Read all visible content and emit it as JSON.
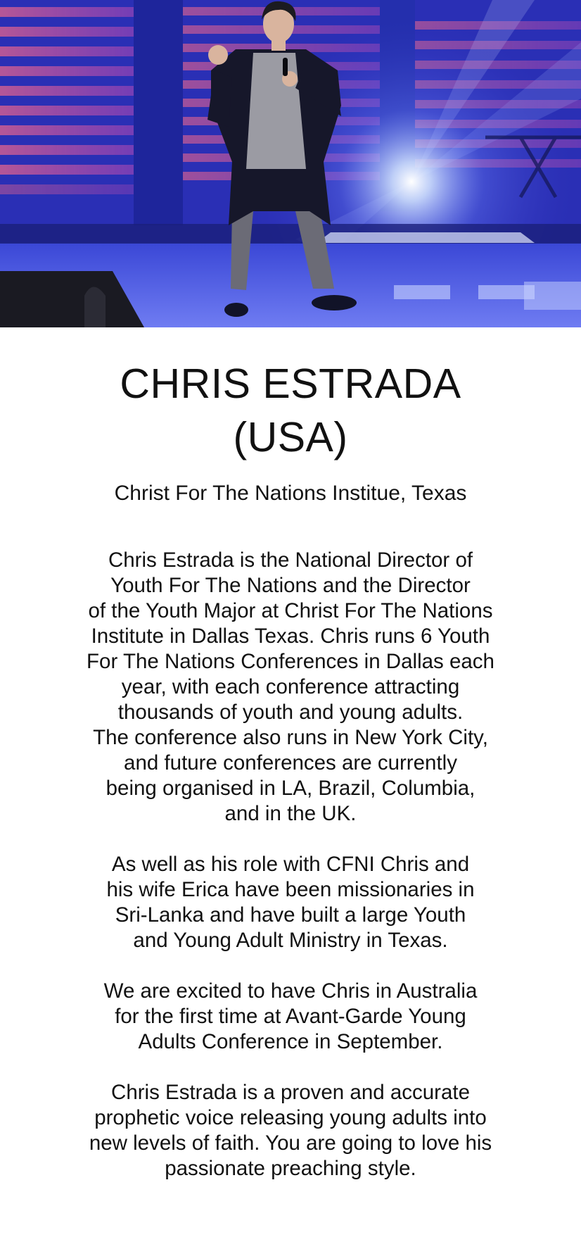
{
  "hero": {
    "image_description_icon": "speaker-on-stage-photo"
  },
  "speaker": {
    "name": "CHRIS ESTRADA\n(USA)",
    "organization": "Christ For The Nations Institue, Texas"
  },
  "bio": {
    "paragraphs": [
      "Chris Estrada is the National Director of\nYouth For The Nations and the Director\nof the Youth Major at Christ For The Nations\nInstitute in Dallas Texas. Chris runs 6 Youth\nFor The Nations Conferences in Dallas each\nyear, with each conference attracting\nthousands of youth and young adults.\nThe conference also runs in New York City,\nand future conferences are currently\nbeing organised in LA, Brazil, Columbia,\nand in the UK.",
      "As well as his role with CFNI Chris and\nhis wife Erica have been missionaries in\nSri-Lanka and have built a large Youth\nand Young Adult Ministry in Texas.",
      "We are excited to have Chris in Australia\nfor the first time at Avant-Garde Young\nAdults Conference in September.",
      "Chris Estrada is a proven and accurate\nprophetic voice releasing young adults into\nnew levels of faith. You are going to love his\npassionate preaching style."
    ]
  }
}
